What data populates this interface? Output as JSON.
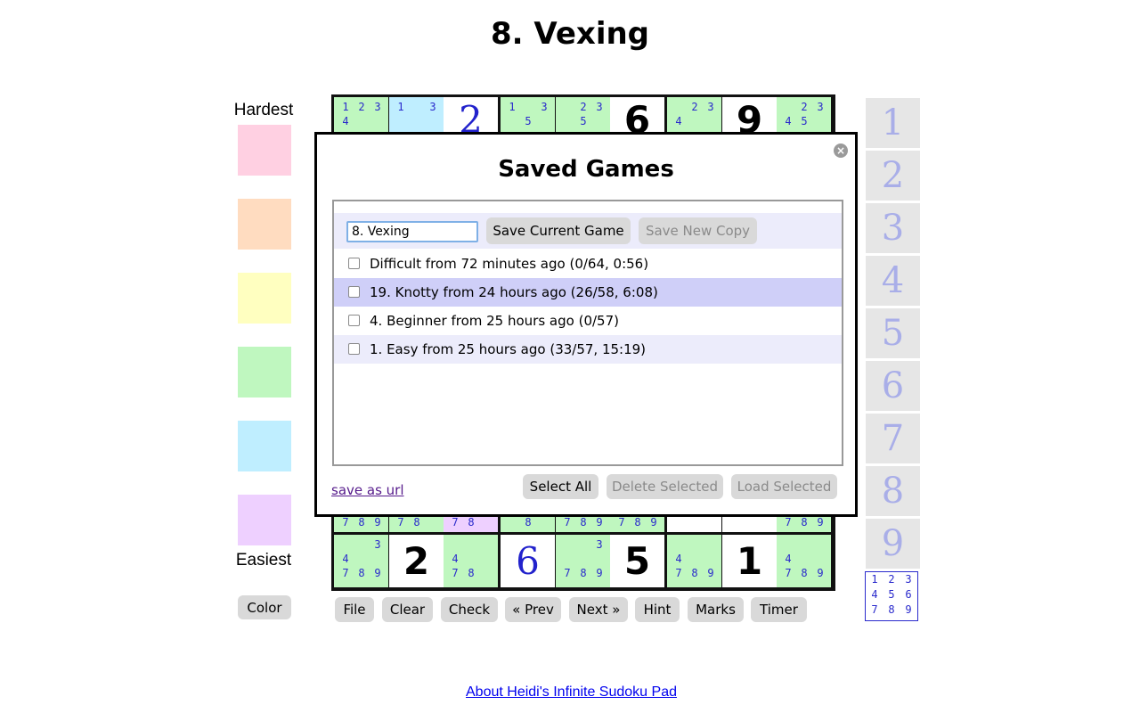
{
  "page": {
    "title": "8. Vexing"
  },
  "palette": {
    "hardest_label": "Hardest",
    "easiest_label": "Easiest",
    "colors": [
      "#ffd0e2",
      "#ffdcc0",
      "#ffffc0",
      "#bff7bf",
      "#bfeeff",
      "#eed0ff"
    ],
    "color_button": "Color"
  },
  "board": {
    "row_top": [
      {
        "cands": [
          "1",
          "2",
          "3",
          "4",
          "",
          "",
          "",
          "",
          ""
        ],
        "bg": "#bff7bf"
      },
      {
        "cands": [
          "1",
          "",
          "3",
          "",
          "",
          "",
          "",
          "",
          ""
        ],
        "bg": "#bfeeff"
      },
      {
        "value": "2",
        "user": true
      },
      {
        "cands": [
          "1",
          "",
          "3",
          "",
          "5",
          "",
          "",
          "",
          ""
        ],
        "bg": "#bff7bf"
      },
      {
        "cands": [
          "",
          "2",
          "3",
          "",
          "5",
          "",
          "",
          "",
          ""
        ],
        "bg": "#bff7bf"
      },
      {
        "value": "6",
        "user": false
      },
      {
        "cands": [
          "",
          "2",
          "3",
          "4",
          "",
          "",
          "",
          "",
          ""
        ],
        "bg": "#bff7bf"
      },
      {
        "value": "9",
        "user": false
      },
      {
        "cands": [
          "",
          "2",
          "3",
          "4",
          "5",
          "",
          "",
          "",
          ""
        ],
        "bg": "#bff7bf"
      }
    ],
    "row_bottom": [
      {
        "cands": [
          "",
          "",
          "3",
          "4",
          "",
          "",
          "7",
          "8",
          "9"
        ],
        "bg": "#bff7bf"
      },
      {
        "value": "2",
        "user": false
      },
      {
        "cands": [
          "",
          "",
          "",
          "4",
          "",
          "",
          "7",
          "8",
          ""
        ],
        "bg": "#bff7bf"
      },
      {
        "value": "6",
        "user": true
      },
      {
        "cands": [
          "",
          "",
          "3",
          "",
          "",
          "",
          "7",
          "8",
          "9"
        ],
        "bg": "#bff7bf"
      },
      {
        "value": "5",
        "user": false
      },
      {
        "cands": [
          "",
          "",
          "",
          "4",
          "",
          "",
          "7",
          "8",
          "9"
        ],
        "bg": "#bff7bf"
      },
      {
        "value": "1",
        "user": false
      },
      {
        "cands": [
          "",
          "",
          "",
          "4",
          "",
          "",
          "7",
          "8",
          "9"
        ],
        "bg": "#bff7bf"
      }
    ],
    "row_partial": [
      {
        "cands": [
          "7",
          "8",
          "9"
        ],
        "bg": "#bff7bf"
      },
      {
        "cands": [
          "7",
          "8",
          ""
        ],
        "bg": "#bff7bf"
      },
      {
        "cands": [
          "7",
          "8",
          ""
        ],
        "bg": "#eed0ff"
      },
      {
        "cands": [
          "",
          "8",
          ""
        ],
        "bg": "#bff7bf"
      },
      {
        "cands": [
          "7",
          "8",
          "9"
        ],
        "bg": "#bff7bf"
      },
      {
        "cands": [
          "7",
          "8",
          "9"
        ],
        "bg": "#bff7bf"
      },
      {
        "given": true
      },
      {
        "given": true
      },
      {
        "cands": [
          "7",
          "8",
          "9"
        ],
        "bg": "#bff7bf"
      }
    ]
  },
  "toolbar": {
    "file": "File",
    "clear": "Clear",
    "check": "Check",
    "prev": "« Prev",
    "next": "Next »",
    "hint": "Hint",
    "marks": "Marks",
    "timer": "Timer"
  },
  "numpad": {
    "keys": [
      "1",
      "2",
      "3",
      "4",
      "5",
      "6",
      "7",
      "8",
      "9"
    ],
    "pencil": [
      "1",
      "2",
      "3",
      "4",
      "5",
      "6",
      "7",
      "8",
      "9"
    ]
  },
  "modal": {
    "title": "Saved Games",
    "close_glyph": "×",
    "name_value": "8. Vexing",
    "save_current": "Save Current Game",
    "save_new_copy": "Save New Copy",
    "games": [
      "Difficult from 72 minutes ago (0/64, 0:56)",
      "19. Knotty from 24 hours ago (26/58, 6:08)",
      "4. Beginner from 25 hours ago (0/57)",
      "1. Easy from 25 hours ago (33/57, 15:19)"
    ],
    "save_as_url": "save as url",
    "select_all": "Select All",
    "delete_selected": "Delete Selected",
    "load_selected": "Load Selected"
  },
  "footer": {
    "about_link": "About Heidi's Infinite Sudoku Pad"
  }
}
